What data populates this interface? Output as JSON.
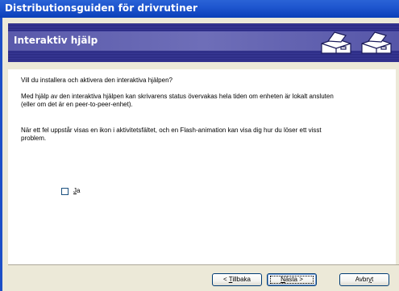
{
  "window": {
    "title": "Distributionsguiden för drivrutiner"
  },
  "banner": {
    "heading": "Interaktiv hjälp",
    "icon": "printer-icon"
  },
  "content": {
    "question": "Vill du installera och aktivera den interaktiva hjälpen?",
    "paragraph1_line1": "Med hjälp av den interaktiva hjälpen kan skrivarens status övervakas hela tiden om enheten är lokalt ansluten",
    "paragraph1_line2": "(eller om det är en peer-to-peer-enhet).",
    "paragraph2_line1": "När ett fel uppstår visas en ikon i aktivitetsfältet, och en Flash-animation kan visa dig hur du löser ett visst",
    "paragraph2_line2": "problem.",
    "checkbox": {
      "mnemonic": "J",
      "rest": "a",
      "checked": false
    }
  },
  "buttons": {
    "back": {
      "prefix": "< ",
      "mnemonic": "T",
      "rest": "illbaka"
    },
    "next": {
      "mnemonic": "N",
      "rest": "ästa >"
    },
    "cancel": {
      "prefix": "Avbr",
      "mnemonic": "y",
      "rest": "t"
    }
  },
  "colors": {
    "titlebar": "#0a3fb8",
    "banner": "#31318c",
    "banner_head": "#6e6eb8"
  }
}
